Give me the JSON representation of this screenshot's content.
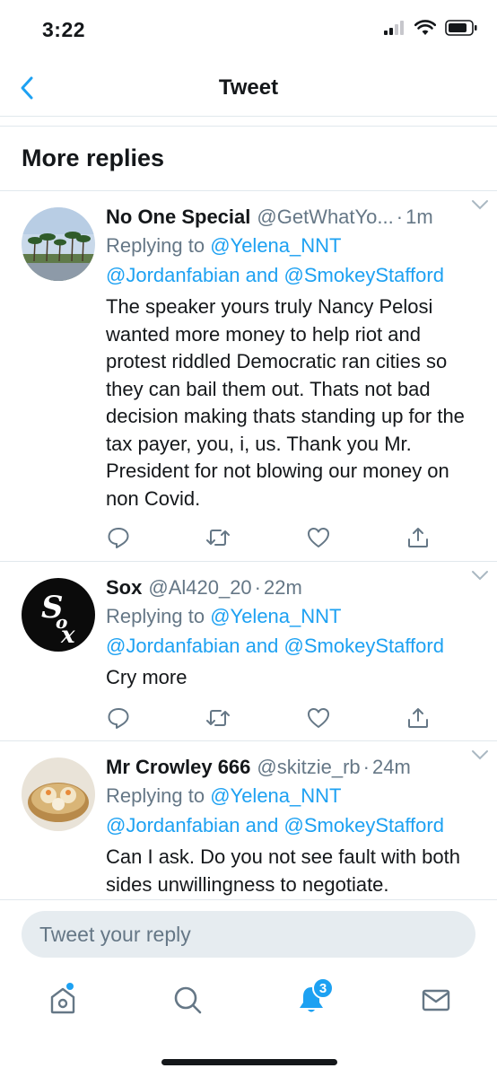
{
  "status_bar": {
    "time": "3:22"
  },
  "nav": {
    "title": "Tweet",
    "back_icon": "chevron-left-icon"
  },
  "section": {
    "title": "More replies"
  },
  "tweets": [
    {
      "display_name": "No One Special",
      "handle": "@GetWhatYo...",
      "separator": "·",
      "time": "1m",
      "replying_prefix": "Replying to",
      "mention_1": "@Yelena_NNT",
      "mention_2": "@Jordanfabian",
      "conj": "and",
      "mention_3": "@SmokeyStafford",
      "text": "The speaker yours truly Nancy Pelosi wanted more money to help riot and protest riddled Democratic ran cities so they can bail them out. Thats not bad decision making thats standing up for the tax payer, you, i, us. Thank you Mr. President for not blowing our money on non Covid."
    },
    {
      "display_name": "Sox",
      "handle": "@Al420_20",
      "separator": "·",
      "time": "22m",
      "replying_prefix": "Replying to",
      "mention_1": "@Yelena_NNT",
      "mention_2": "@Jordanfabian",
      "conj": "and",
      "mention_3": "@SmokeyStafford",
      "text": "Cry more"
    },
    {
      "display_name": "Mr Crowley 666",
      "handle": "@skitzie_rb",
      "separator": "·",
      "time": "24m",
      "replying_prefix": "Replying to",
      "mention_1": "@Yelena_NNT",
      "mention_2": "@Jordanfabian",
      "conj": "and",
      "mention_3": "@SmokeyStafford",
      "text": "Can I ask. Do you not see fault with both sides unwillingness to negotiate."
    }
  ],
  "composer": {
    "placeholder": "Tweet your reply"
  },
  "tab_bar": {
    "notifications_badge": "3"
  },
  "colors": {
    "accent": "#1da1f2",
    "secondary_text": "#657786",
    "divider": "#e1e8ed"
  }
}
